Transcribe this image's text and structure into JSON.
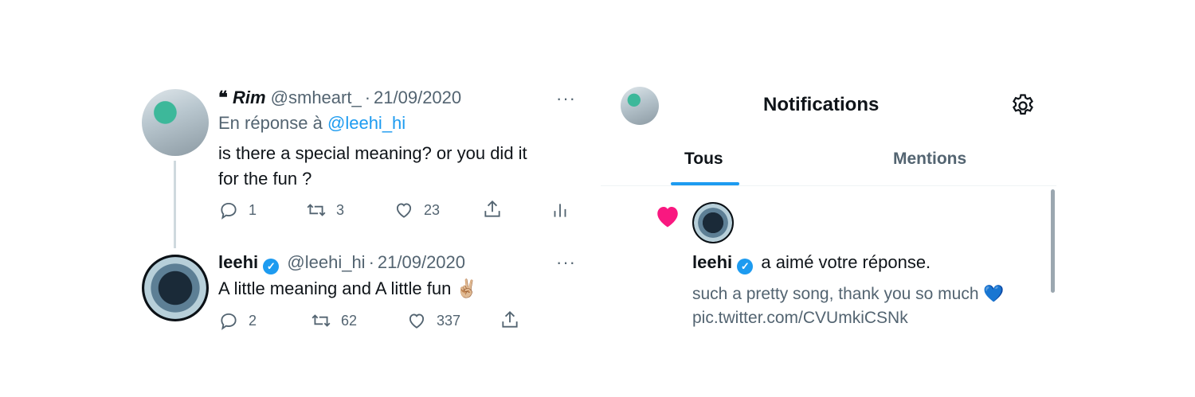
{
  "thread": {
    "reply": {
      "display_name": "Rim",
      "name_prefix": "❝",
      "handle": "@smheart_",
      "separator": "·",
      "date": "21/09/2020",
      "reply_to_label": "En réponse à",
      "reply_to_handle": "@leehi_hi",
      "text_line1": "is there a special meaning? or you did it",
      "text_line2": "for the fun ?",
      "more": "···",
      "replies": "1",
      "retweets": "3",
      "likes": "23"
    },
    "response": {
      "display_name": "leehi",
      "verified_mark": "✓",
      "handle": "@leehi_hi",
      "separator": "·",
      "date": "21/09/2020",
      "text": "A little meaning and A little fun ✌🏼",
      "more": "···",
      "replies": "2",
      "retweets": "62",
      "likes": "337"
    }
  },
  "notifications": {
    "title": "Notifications",
    "tabs": [
      {
        "label": "Tous",
        "active": true
      },
      {
        "label": "Mentions",
        "active": false
      }
    ],
    "item": {
      "user": "leehi",
      "verified_mark": "✓",
      "action_text": "a aimé votre réponse.",
      "quoted_text": "such a pretty song, thank you so much 💙",
      "link": "pic.twitter.com/CVUmkiCSNk"
    }
  },
  "icons": {
    "reply": "reply-icon",
    "retweet": "retweet-icon",
    "like": "heart-outline-icon",
    "share": "share-icon",
    "analytics": "analytics-icon",
    "settings": "gear-icon",
    "notification_like": "heart-filled-icon",
    "verified": "verified-badge-icon"
  },
  "colors": {
    "accent": "#1d9bf0",
    "muted": "#536471",
    "like": "#f91880"
  }
}
